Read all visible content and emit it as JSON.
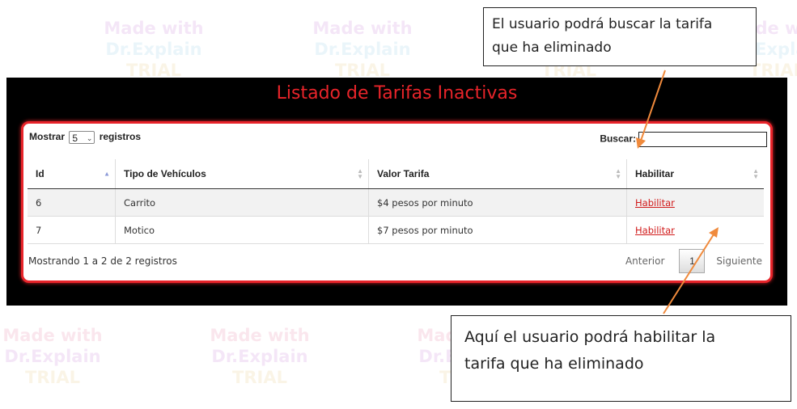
{
  "watermark": {
    "line1": "Made with",
    "line2": "Dr.Explain",
    "line3": "TRIAL"
  },
  "header": {
    "title": "Listado de Tarifas Inactivas"
  },
  "length_menu": {
    "prefix": "Mostrar",
    "selected": "5",
    "suffix": "registros"
  },
  "search": {
    "label": "Buscar:",
    "value": ""
  },
  "table": {
    "columns": [
      "Id",
      "Tipo de Vehículos",
      "Valor Tarifa",
      "Habilitar"
    ],
    "rows": [
      {
        "id": "6",
        "tipo": "Carrito",
        "valor": "$4 pesos por minuto",
        "accion": "Habilitar"
      },
      {
        "id": "7",
        "tipo": "Motico",
        "valor": "$7 pesos por minuto",
        "accion": "Habilitar"
      }
    ]
  },
  "info": "Mostrando 1 a 2 de 2 registros",
  "pagination": {
    "previous": "Anterior",
    "page": "1",
    "next": "Siguiente"
  },
  "callouts": {
    "search_note": {
      "line1": "El usuario podrá buscar la tarifa",
      "line2": "que ha eliminado"
    },
    "enable_note": {
      "line1": "Aquí el usuario podrá habilitar la",
      "line2": "tarifa que ha eliminado"
    }
  },
  "colors": {
    "accent": "#e8242a",
    "link": "#d11a1a",
    "arrow": "#f08a3c",
    "background": "#000000"
  }
}
